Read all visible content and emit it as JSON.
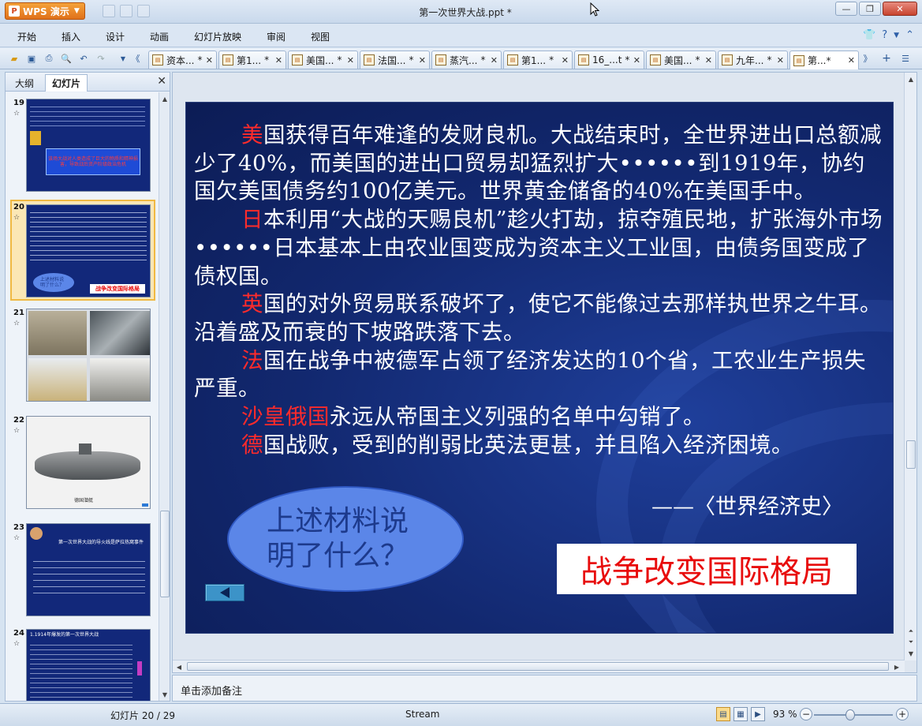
{
  "app": {
    "name": "WPS 演示",
    "doc_title": "第一次世界大战.ppt *",
    "window_buttons": [
      "minimize",
      "maximize",
      "close"
    ]
  },
  "menu": [
    "开始",
    "插入",
    "设计",
    "动画",
    "幻灯片放映",
    "审阅",
    "视图"
  ],
  "doc_tabs": [
    {
      "label": "资本...",
      "modified": "*"
    },
    {
      "label": "第1...",
      "modified": "*"
    },
    {
      "label": "美国...",
      "modified": "*"
    },
    {
      "label": "法国...",
      "modified": "*"
    },
    {
      "label": "蒸汽...",
      "modified": "*"
    },
    {
      "label": "第1...",
      "modified": "*"
    },
    {
      "label": "16_...t",
      "modified": "*"
    },
    {
      "label": "美国...",
      "modified": "*"
    },
    {
      "label": "九年...",
      "modified": "*"
    },
    {
      "label": "第...*",
      "modified": "",
      "active": true
    }
  ],
  "left_pane": {
    "tabs": [
      "大纲",
      "幻灯片"
    ],
    "active_tab": "幻灯片",
    "slides": [
      {
        "num": "19",
        "star": "☆",
        "caption": "该场大战对人类造成了巨大的物质和精神损害，导致战后资产阶级政治危机"
      },
      {
        "num": "20",
        "star": "☆",
        "selected": true,
        "bubble": "上述材料说明了什么？",
        "answer": "战争改变国际格局"
      },
      {
        "num": "21",
        "star": "☆"
      },
      {
        "num": "22",
        "star": "☆",
        "caption": "德国潜艇"
      },
      {
        "num": "23",
        "star": "☆",
        "caption": "第一次世界大战的导火线是萨拉热窝事件"
      },
      {
        "num": "24",
        "star": "☆",
        "caption": "1.1914年爆发的第一次世界大战"
      }
    ]
  },
  "slide": {
    "paragraphs": [
      {
        "lead": "美",
        "rest": "国获得百年难逢的发财良机。大战结束时，全世界进出口总额减少了40%，而美国的进出口贸易却猛烈扩大••••••到1919年，协约国欠美国债务约100亿美元。世界黄金储备的40%在美国手中。"
      },
      {
        "lead": "日",
        "rest": "本利用“大战的天赐良机”趁火打劫，掠夺殖民地，扩张海外市场••••••日本基本上由农业国变成为资本主义工业国，由债务国变成了债权国。"
      },
      {
        "lead": "英",
        "rest": "国的对外贸易联系破坏了，使它不能像过去那样执世界之牛耳。沿着盛及而衰的下坡路跌落下去。"
      },
      {
        "lead": "法",
        "rest": "国在战争中被德军占领了经济发达的10个省，工农业生产损失严重。"
      },
      {
        "lead": "沙皇俄国",
        "rest": "永远从帝国主义列强的名单中勾销了。"
      },
      {
        "lead": "德",
        "rest": "国战败，受到的削弱比英法更甚，并且陷入经济困境。"
      }
    ],
    "citation": "——〈世界经济史〉",
    "question": "上述材料说明了什么？",
    "answer": "战争改变国际格局"
  },
  "notes_placeholder": "单击添加备注",
  "status": {
    "slide_counter": "幻灯片 20 / 29",
    "theme": "Stream",
    "zoom": "93 %",
    "zoom_fraction": 0.46
  },
  "colors": {
    "slide_bg": "#12286f",
    "highlight_red": "#ff2b2b",
    "answer_red": "#e80c0c",
    "bubble_fill": "#5b86e8"
  }
}
